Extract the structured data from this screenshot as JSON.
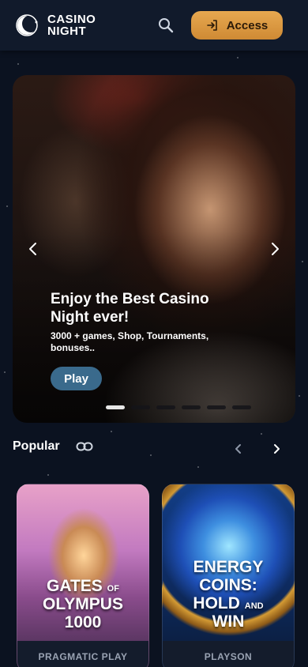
{
  "header": {
    "logo_line1": "CASINO",
    "logo_line2": "NIGHT",
    "search_icon": "search-icon",
    "access_label": "Access",
    "access_icon": "login-icon"
  },
  "hero": {
    "title": "Enjoy the Best Casino Night ever!",
    "subtitle": "3000 + games, Shop, Tournaments, bonuses..",
    "play_label": "Play",
    "slide_count": 6,
    "active_slide": 0
  },
  "popular": {
    "title": "Popular",
    "games": [
      {
        "art_line1": "GATES",
        "art_of": "OF",
        "art_line2": "OLYMPUS",
        "art_line3": "1000",
        "provider": "PRAGMATIC PLAY"
      },
      {
        "art_line1": "ENERGY",
        "art_line2": "COINS:",
        "art_line3": "HOLD",
        "art_and": "AND",
        "art_line4": "WIN",
        "provider": "PLAYSON"
      }
    ]
  },
  "colors": {
    "background": "#0b1220",
    "header": "#111a2b",
    "accent_gold": "#e0a048",
    "play_button": "#3a6a8c"
  }
}
